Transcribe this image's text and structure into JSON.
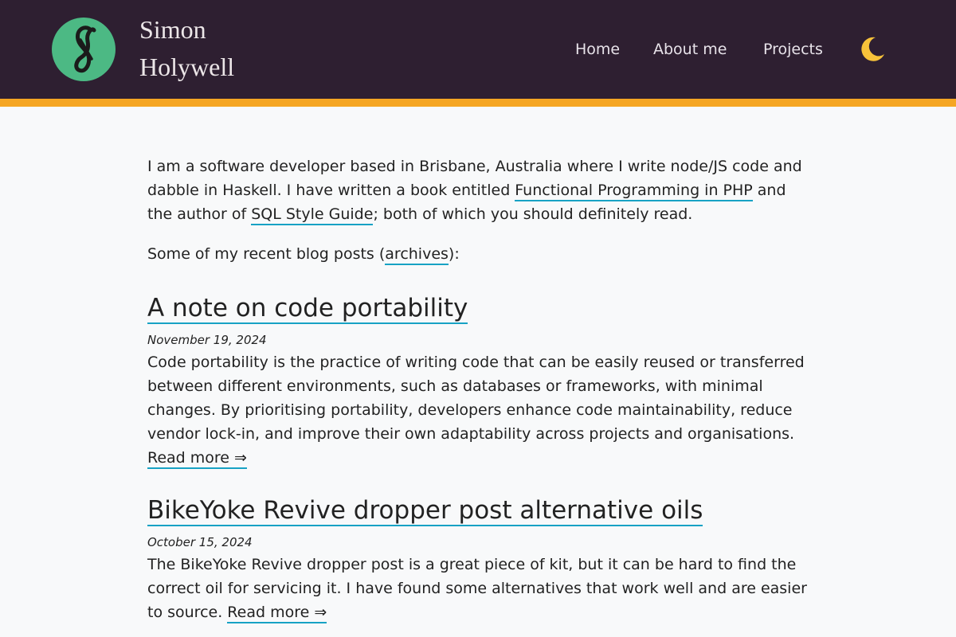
{
  "header": {
    "site_title_line1": "Simon",
    "site_title_line2": "Holywell",
    "nav": [
      {
        "label": "Home"
      },
      {
        "label": "About me"
      },
      {
        "label": "Projects"
      }
    ],
    "theme_toggle_icon": "moon-icon",
    "colors": {
      "header_bg": "#2e1f31",
      "accent_bar": "#f5a623",
      "logo_bg": "#4cb984",
      "link_underline": "#17a2c4"
    }
  },
  "intro": {
    "text1": "I am a software developer based in Brisbane, Australia where I write node/JS code and dabble in Haskell. I have written a book entitled ",
    "book_link": "Functional Programming in PHP",
    "text2": " and the author of ",
    "guide_link": "SQL Style Guide",
    "text3": "; both of which you should definitely read."
  },
  "recent": {
    "text1": "Some of my recent blog posts (",
    "archives_link": "archives",
    "text2": "):"
  },
  "posts": [
    {
      "title": "A note on code portability",
      "date": "November 19, 2024",
      "excerpt": "Code portability is the practice of writing code that can be easily reused or transferred between different environments, such as databases or frameworks, with minimal changes. By prioritising portability, developers enhance code maintainability, reduce vendor lock-in, and improve their own adaptability across projects and organisations. ",
      "read_more": "Read more ⇒"
    },
    {
      "title": "BikeYoke Revive dropper post alternative oils",
      "date": "October 15, 2024",
      "excerpt": "The BikeYoke Revive dropper post is a great piece of kit, but it can be hard to find the correct oil for servicing it. I have found some alternatives that work well and are easier to source. ",
      "read_more": "Read more ⇒"
    }
  ]
}
